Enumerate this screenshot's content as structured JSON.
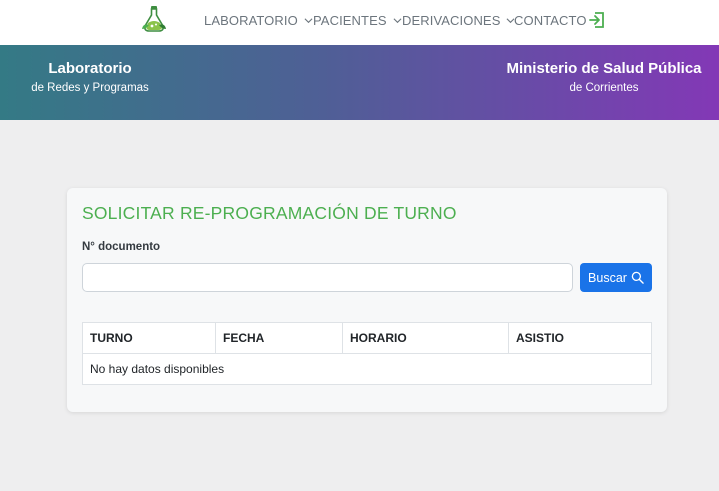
{
  "nav": {
    "logo_icon": "flask-leaf-icon",
    "items": [
      {
        "label": "LABORATORIO"
      },
      {
        "label": "PACIENTES"
      },
      {
        "label": "DERIVACIONES"
      },
      {
        "label": "CONTACTO"
      }
    ],
    "exit_icon": "sign-out-icon"
  },
  "banner": {
    "left_title": "Laboratorio",
    "left_sub": "de Redes y Programas",
    "right_title": "Ministerio de Salud Pública",
    "right_sub": "de Corrientes"
  },
  "card": {
    "title": "SOLICITAR RE-PROGRAMACIÓN DE TURNO",
    "doc_label": "N° documento",
    "doc_value": "",
    "doc_placeholder": "",
    "search_label": "Buscar",
    "search_icon": "search-icon"
  },
  "table": {
    "headers": [
      "TURNO",
      "FECHA",
      "HORARIO",
      "ASISTIO"
    ],
    "empty_text": "No hay datos disponibles"
  },
  "colors": {
    "accent_green": "#4caf50",
    "button_blue": "#1a73e8",
    "banner_start": "#347a85",
    "banner_end": "#8338b6"
  }
}
